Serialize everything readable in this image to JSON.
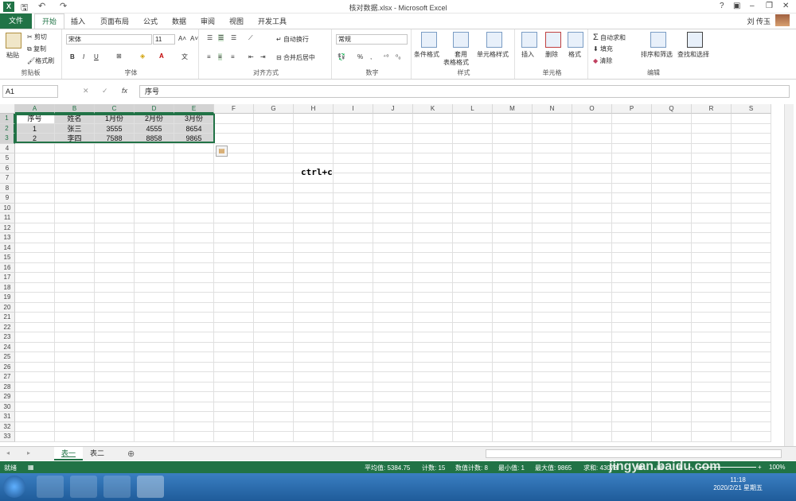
{
  "window": {
    "title": "核对数据.xlsx - Microsoft Excel",
    "help": "?",
    "user": "刘 传玉"
  },
  "tabs": [
    "文件",
    "开始",
    "插入",
    "页面布局",
    "公式",
    "数据",
    "审阅",
    "视图",
    "开发工具"
  ],
  "ribbon": {
    "clipboard": {
      "label": "剪贴板",
      "paste": "粘贴",
      "cut": "剪切",
      "copy": "复制",
      "format_painter": "格式刷"
    },
    "font": {
      "label": "字体",
      "name": "宋体",
      "size": "11",
      "bold": "B",
      "italic": "I",
      "underline": "U"
    },
    "alignment": {
      "label": "对齐方式",
      "wrap": "自动换行",
      "merge": "合并后居中"
    },
    "number": {
      "label": "数字",
      "format": "常规",
      "percent": "%",
      "comma": ","
    },
    "styles": {
      "label": "样式",
      "conditional": "条件格式",
      "table": "套用",
      "table2": "表格格式",
      "cell_styles": "单元格样式"
    },
    "cells": {
      "label": "单元格",
      "insert": "插入",
      "delete": "删除",
      "format": "格式"
    },
    "editing": {
      "label": "编辑",
      "autosum": "自动求和",
      "fill": "填充",
      "clear": "清除",
      "sort": "排序和筛选",
      "find": "查找和选择"
    }
  },
  "formula_bar": {
    "namebox": "A1",
    "fx": "fx",
    "content": "序号"
  },
  "columns": [
    "A",
    "B",
    "C",
    "D",
    "E",
    "F",
    "G",
    "H",
    "I",
    "J",
    "K",
    "L",
    "M",
    "N",
    "O",
    "P",
    "Q",
    "R",
    "S"
  ],
  "rows": [
    "1",
    "2",
    "3",
    "4",
    "5",
    "6",
    "7",
    "8",
    "9",
    "10",
    "11",
    "12",
    "13",
    "14",
    "15",
    "16",
    "17",
    "18",
    "19",
    "20",
    "21",
    "22",
    "23",
    "24",
    "25",
    "26",
    "27",
    "28",
    "29",
    "30",
    "31",
    "32",
    "33"
  ],
  "table": [
    [
      "序号",
      "姓名",
      "1月份",
      "2月份",
      "3月份"
    ],
    [
      "1",
      "张三",
      "3555",
      "4555",
      "8654"
    ],
    [
      "2",
      "李四",
      "7588",
      "8858",
      "9865"
    ]
  ],
  "annotation": "ctrl+c",
  "sheets": [
    "表一",
    "表二"
  ],
  "status": {
    "ready": "就绪",
    "average": "平均值: 5384.75",
    "count": "计数: 15",
    "numcount": "数值计数: 8",
    "min": "最小值: 1",
    "max": "最大值: 9865",
    "sum": "求和: 43078",
    "zoom": "100%"
  },
  "clock": {
    "time": "11:18",
    "date": "2020/2/21 星期五"
  },
  "watermark": "jingyan.baidu.com"
}
